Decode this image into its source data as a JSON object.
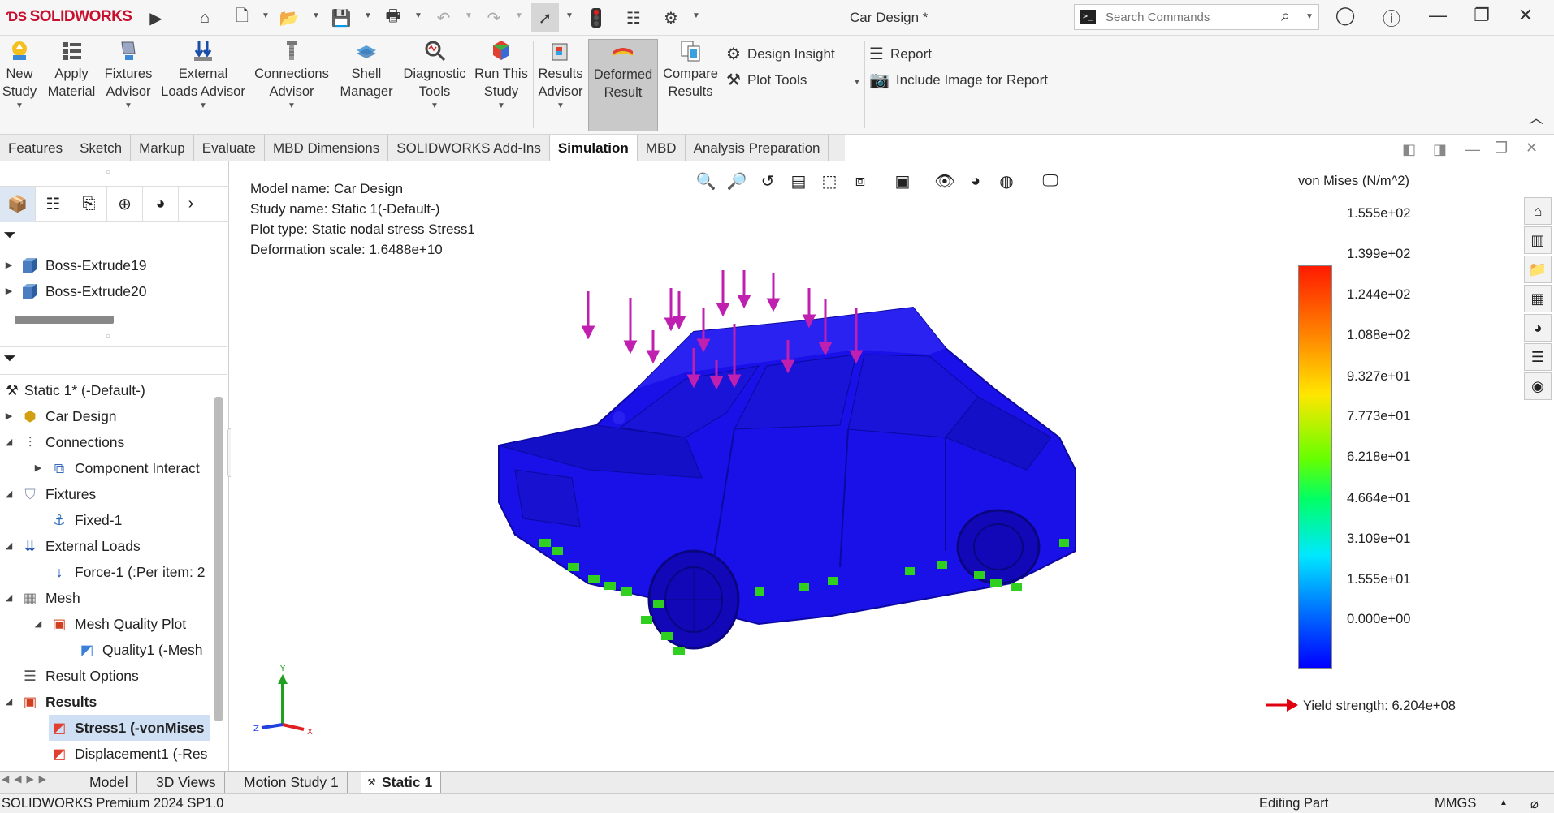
{
  "app": {
    "brand": "SOLIDWORKS",
    "doc_title": "Car Design *",
    "search_placeholder": "Search Commands"
  },
  "ribbon": {
    "buttons": [
      {
        "line1": "New",
        "line2": "Study"
      },
      {
        "line1": "Apply",
        "line2": "Material"
      },
      {
        "line1": "Fixtures",
        "line2": "Advisor"
      },
      {
        "line1": "External",
        "line2": "Loads Advisor"
      },
      {
        "line1": "Connections",
        "line2": "Advisor"
      },
      {
        "line1": "Shell",
        "line2": "Manager"
      },
      {
        "line1": "Diagnostic",
        "line2": "Tools"
      },
      {
        "line1": "Run This",
        "line2": "Study"
      },
      {
        "line1": "Results",
        "line2": "Advisor"
      },
      {
        "line1": "Deformed",
        "line2": "Result"
      },
      {
        "line1": "Compare",
        "line2": "Results"
      }
    ],
    "design_insight": "Design Insight",
    "plot_tools": "Plot Tools",
    "report": "Report",
    "include_image": "Include Image for Report"
  },
  "command_tabs": [
    "Features",
    "Sketch",
    "Markup",
    "Evaluate",
    "MBD Dimensions",
    "SOLIDWORKS Add-Ins",
    "Simulation",
    "MBD",
    "Analysis Preparation"
  ],
  "active_command_tab": "Simulation",
  "feature_tree": {
    "top_items": [
      "Boss-Extrude19",
      "Boss-Extrude20"
    ],
    "study": "Static 1* (-Default-)",
    "items": [
      "Car Design",
      "Connections",
      "Component Interact",
      "Fixtures",
      "Fixed-1",
      "External Loads",
      "Force-1 (:Per item: 2",
      "Mesh",
      "Mesh Quality Plot",
      "Quality1 (-Mesh",
      "Result Options",
      "Results",
      "Stress1 (-vonMises",
      "Displacement1 (-Res"
    ]
  },
  "plot_info": {
    "model_name": "Model name: Car Design",
    "study_name": "Study name: Static 1(-Default-)",
    "plot_type": "Plot type: Static nodal stress Stress1",
    "deformation_scale": "Deformation scale: 1.6488e+10"
  },
  "legend": {
    "title": "von Mises (N/m^2)",
    "values": [
      "1.555e+02",
      "1.399e+02",
      "1.244e+02",
      "1.088e+02",
      "9.327e+01",
      "7.773e+01",
      "6.218e+01",
      "4.664e+01",
      "3.109e+01",
      "1.555e+01",
      "0.000e+00"
    ],
    "yield_strength": "Yield strength: 6.204e+08"
  },
  "triad": {
    "x": "X",
    "y": "Y",
    "z": "Z"
  },
  "bottom_tabs": [
    "Model",
    "3D Views",
    "Motion Study 1",
    "Static 1"
  ],
  "active_bottom_tab": "Static 1",
  "status": {
    "product": "SOLIDWORKS Premium 2024 SP1.0",
    "mode": "Editing Part",
    "units": "MMGS"
  },
  "colors": {
    "brand_red": "#c8102e",
    "car_body": "#1a10e8",
    "load_arrows": "#c020b0",
    "fixtures": "#30d020"
  }
}
